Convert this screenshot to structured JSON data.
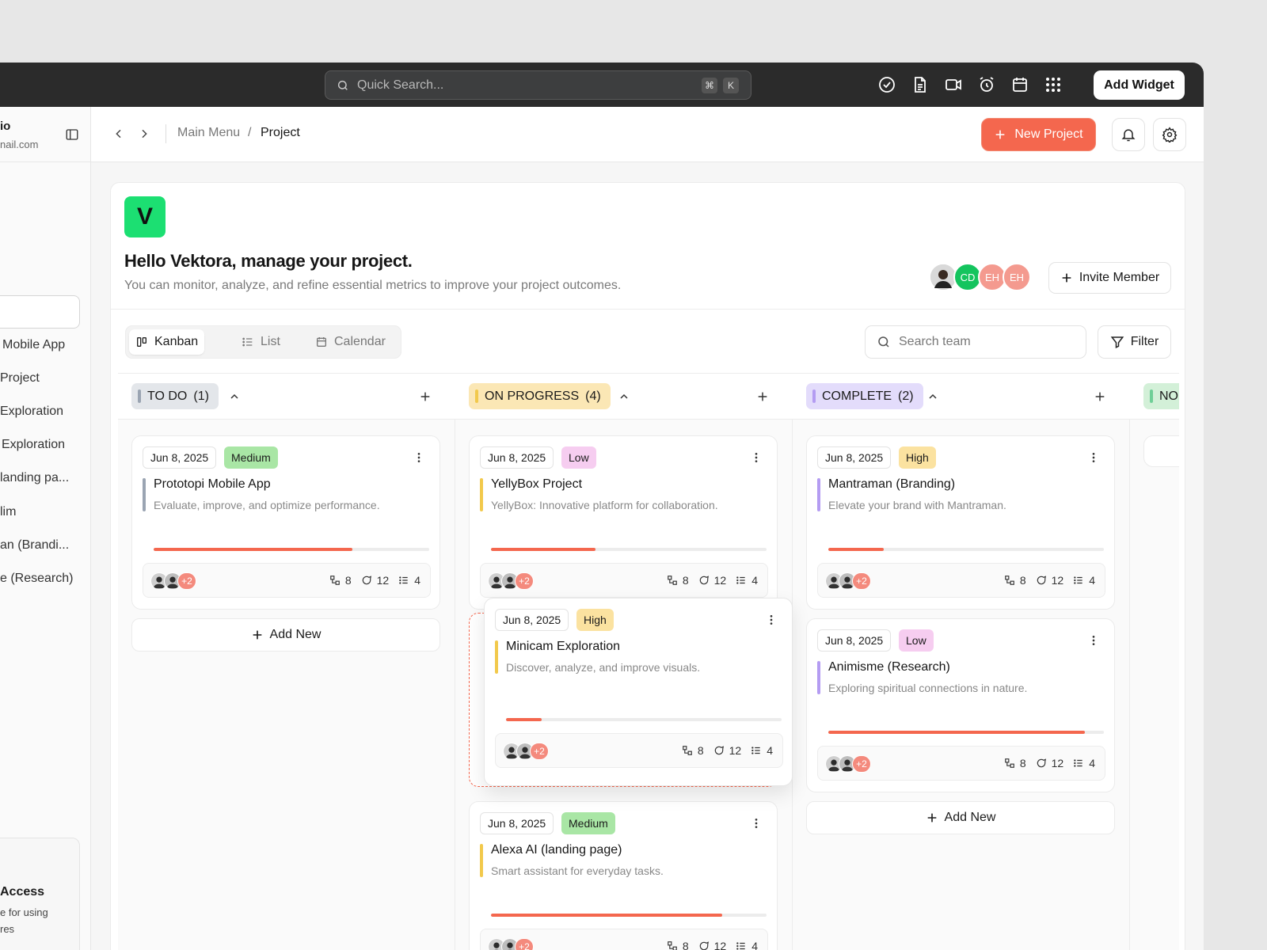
{
  "topbar": {
    "search_placeholder": "Quick Search...",
    "kbd_cmd": "⌘",
    "kbd_k": "K",
    "add_widget": "Add Widget"
  },
  "sidebar": {
    "user_name": "io",
    "user_email": "nail.com",
    "items": [
      "Mobile App",
      "Project",
      "Exploration",
      "Exploration",
      "landing pa...",
      "lim",
      "an (Brandi...",
      "e (Research)"
    ],
    "promo_title": "Access",
    "promo_text_1": "e for using",
    "promo_text_2": "res"
  },
  "header": {
    "crumb_root": "Main Menu",
    "crumb_sep": "/",
    "crumb_current": "Project",
    "new_project": "New Project"
  },
  "project": {
    "logo_letter": "V",
    "title": "Hello Vektora, manage your project.",
    "subtitle": "You can monitor, analyze, and refine essential metrics to improve your project outcomes.",
    "members": [
      "CD",
      "EH",
      "EH"
    ],
    "invite": "Invite Member"
  },
  "views": {
    "kanban": "Kanban",
    "list": "List",
    "calendar": "Calendar",
    "search_placeholder": "Search team",
    "filter": "Filter"
  },
  "colors": {
    "accent": "#f4674e",
    "todo": "#9aa4b2",
    "progress": "#f2c94c",
    "complete": "#b49cf2",
    "next": "#6fcf97"
  },
  "columns": [
    {
      "label": "TO DO",
      "count": "(1)",
      "cards": [
        {
          "date": "Jun 8, 2025",
          "priority": "Medium",
          "title": "Prototopi  Mobile App",
          "desc": "Evaluate, improve, and optimize performance.",
          "progress": 0.72,
          "plus": "+2",
          "subtasks": "8",
          "comments": "12",
          "lists": "4"
        }
      ],
      "add_new": "Add New"
    },
    {
      "label": "ON PROGRESS",
      "count": "(4)",
      "cards": [
        {
          "date": "Jun 8, 2025",
          "priority": "Low",
          "title": "YellyBox Project",
          "desc": "YellyBox: Innovative platform for collaboration.",
          "progress": 0.38,
          "plus": "+2",
          "subtasks": "8",
          "comments": "12",
          "lists": "4"
        },
        {
          "date": "Jun 8, 2025",
          "priority": "High",
          "title": "Minicam Exploration",
          "desc": "Discover, analyze, and improve visuals.",
          "progress": 0.13,
          "plus": "+2",
          "subtasks": "8",
          "comments": "12",
          "lists": "4"
        },
        {
          "date": "Jun 8, 2025",
          "priority": "Medium",
          "title": "Alexa AI (landing page)",
          "desc": "Smart assistant for everyday tasks.",
          "progress": 0.84,
          "plus": "+2",
          "subtasks": "8",
          "comments": "12",
          "lists": "4"
        }
      ]
    },
    {
      "label": "COMPLETE",
      "count": "(2)",
      "cards": [
        {
          "date": "Jun 8, 2025",
          "priority": "High",
          "title": "Mantraman (Branding)",
          "desc": "Elevate your brand with Mantraman.",
          "progress": 0.2,
          "plus": "+2",
          "subtasks": "8",
          "comments": "12",
          "lists": "4"
        },
        {
          "date": "Jun 8, 2025",
          "priority": "Low",
          "title": "Animisme (Research)",
          "desc": "Exploring spiritual connections in nature.",
          "progress": 0.93,
          "plus": "+2",
          "subtasks": "8",
          "comments": "12",
          "lists": "4"
        }
      ],
      "add_new": "Add New"
    },
    {
      "label": "NO"
    }
  ]
}
